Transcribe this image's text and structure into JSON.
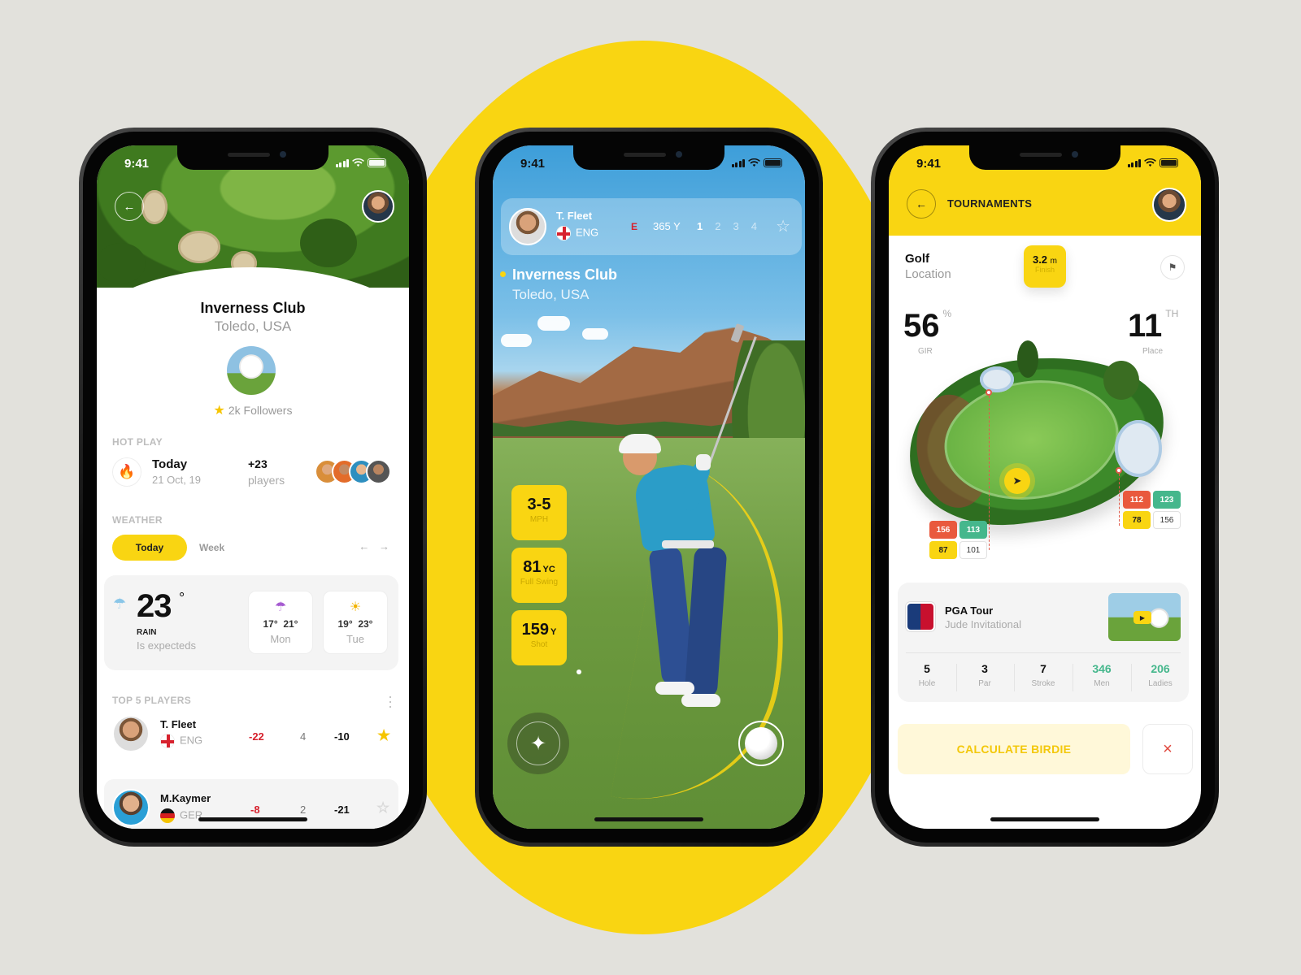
{
  "status": {
    "time": "9:41"
  },
  "club": {
    "name": "Inverness Club",
    "location": "Toledo, USA",
    "followers": "2k Followers"
  },
  "hot_play": {
    "label": "HOT PLAY",
    "day": "Today",
    "date": "21 Oct, 19",
    "count": "+23",
    "count_label": "players"
  },
  "weather": {
    "label": "WEATHER",
    "tabs": [
      "Today",
      "Week"
    ],
    "arrows": "← →",
    "temp": "23",
    "degree": "°",
    "condition": "RAIN",
    "note": "Is expecteds",
    "days": [
      {
        "low": "17°",
        "high": "21°",
        "name": "Mon",
        "icon": "umbrella-icon"
      },
      {
        "low": "19°",
        "high": "23°",
        "name": "Tue",
        "icon": "sun-cloud-icon"
      }
    ]
  },
  "top_players": {
    "label": "TOP 5 PLAYERS",
    "rows": [
      {
        "name": "T. Fleet",
        "country": "ENG",
        "score1": "-22",
        "score2": "4",
        "score3": "-10",
        "starred": true
      },
      {
        "name": "M.Kaymer",
        "country": "GER",
        "score1": "-8",
        "score2": "2",
        "score3": "-21",
        "starred": false
      }
    ]
  },
  "play_view": {
    "player_name": "T. Fleet",
    "player_country": "ENG",
    "par_mark": "E",
    "yards": "365 Y",
    "rounds": [
      "1",
      "2",
      "3",
      "4"
    ],
    "club_name": "Inverness Club",
    "club_location": "Toledo, USA",
    "stats": [
      {
        "value": "3-5",
        "unit": "",
        "label": "MPH"
      },
      {
        "value": "81",
        "unit": "YC",
        "label": "Full Swing"
      },
      {
        "value": "159",
        "unit": "Y",
        "label": "Shot"
      }
    ]
  },
  "tournaments": {
    "title": "TOURNAMENTS",
    "golf": "Golf",
    "location": "Location",
    "distance": "3.2",
    "distance_unit": "m",
    "distance_label": "Finish",
    "gir_value": "56",
    "gir_unit": "%",
    "gir_label": "GIR",
    "place_value": "11",
    "place_unit": "TH",
    "place_label": "Place",
    "left_boxes": [
      "156",
      "113",
      "87",
      "101"
    ],
    "right_boxes": [
      "112",
      "123",
      "78",
      "156"
    ],
    "event": {
      "name": "PGA Tour",
      "subtitle": "Jude Invitational"
    },
    "event_stats": [
      {
        "value": "5",
        "label": "Hole"
      },
      {
        "value": "3",
        "label": "Par"
      },
      {
        "value": "7",
        "label": "Stroke"
      },
      {
        "value": "346",
        "label": "Men"
      },
      {
        "value": "206",
        "label": "Ladies"
      }
    ],
    "cta": "CALCULATE BIRDIE",
    "close": "×"
  },
  "colors": {
    "accent": "#f9d512",
    "red": "#e9593d",
    "teal": "#45b78c",
    "background": "#e2e1dc"
  }
}
